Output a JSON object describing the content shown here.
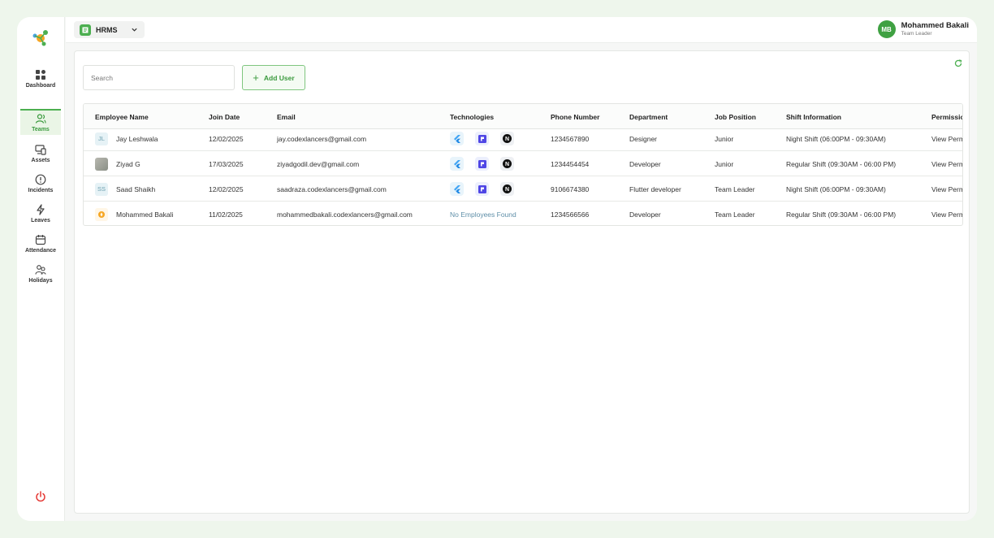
{
  "app": {
    "name": "HRMS"
  },
  "user": {
    "initials": "MB",
    "name": "Mohammed Bakali",
    "role": "Team Leader"
  },
  "sidebar": {
    "items": [
      {
        "label": "Dashboard",
        "icon": "grid-icon"
      },
      {
        "label": "Teams",
        "icon": "users-icon",
        "active": true
      },
      {
        "label": "Assets",
        "icon": "devices-icon"
      },
      {
        "label": "Incidents",
        "icon": "alert-circle-icon"
      },
      {
        "label": "Leaves",
        "icon": "bolt-icon"
      },
      {
        "label": "Attendance",
        "icon": "calendar-icon"
      },
      {
        "label": "Holidays",
        "icon": "people-icon"
      }
    ]
  },
  "toolbar": {
    "search_placeholder": "Search",
    "add_user_label": "Add User"
  },
  "table": {
    "headers": {
      "name": "Employee Name",
      "join": "Join Date",
      "email": "Email",
      "tech": "Technologies",
      "phone": "Phone Number",
      "dept": "Department",
      "job": "Job Position",
      "shift": "Shift Information",
      "perm": "Permissions"
    },
    "rows": [
      {
        "avatar": "JL",
        "name": "Jay Leshwala",
        "join": "12/02/2025",
        "email": "jay.codexlancers@gmail.com",
        "tech": [
          "flutter-icon",
          "ui-icon",
          "nextjs-icon"
        ],
        "phone": "1234567890",
        "dept": "Designer",
        "job": "Junior",
        "shift": "Night Shift (06:00PM - 09:30AM)",
        "perm": "View Permissions"
      },
      {
        "avatar": "",
        "name": "Ziyad G",
        "join": "17/03/2025",
        "email": "ziyadgodil.dev@gmail.com",
        "tech": [
          "flutter-icon",
          "ui-icon",
          "nextjs-icon"
        ],
        "phone": "1234454454",
        "dept": "Developer",
        "job": "Junior",
        "shift": "Regular Shift (09:30AM - 06:00 PM)",
        "perm": "View Permissions"
      },
      {
        "avatar": "SS",
        "name": "Saad  Shaikh",
        "join": "12/02/2025",
        "email": "saadraza.codexlancers@gmail.com",
        "tech": [
          "flutter-icon",
          "ui-icon",
          "nextjs-icon"
        ],
        "phone": "9106674380",
        "dept": "Flutter developer",
        "job": "Team Leader",
        "shift": "Night Shift (06:00PM - 09:30AM)",
        "perm": "View Permissions"
      },
      {
        "avatar": "",
        "name": "Mohammed Bakali",
        "join": "11/02/2025",
        "email": "mohammedbakali.codexlancers@gmail.com",
        "tech_text": "No Employees Found",
        "phone": "1234566566",
        "dept": "Developer",
        "job": "Team Leader",
        "shift": "Regular Shift (09:30AM - 06:00 PM)",
        "perm": "View Permissions"
      }
    ]
  },
  "colors": {
    "accent": "#4caf50",
    "accent_dark": "#3a9a3e",
    "power": "#e53935"
  }
}
